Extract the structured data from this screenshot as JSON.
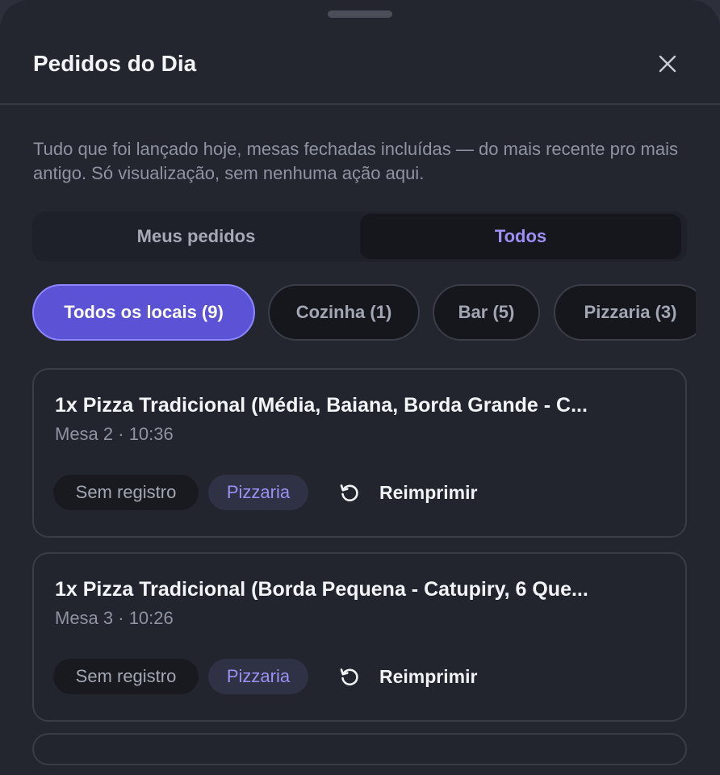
{
  "header": {
    "title": "Pedidos do Dia",
    "close_icon": "close-icon"
  },
  "description": "Tudo que foi lançado hoje, mesas fechadas incluídas — do mais recente pro mais antigo. Só visualização, sem nenhuma ação aqui.",
  "segments": {
    "mine": "Meus pedidos",
    "all": "Todos",
    "selected": "all"
  },
  "filters": [
    {
      "label": "Todos os locais (9)",
      "active": true
    },
    {
      "label": "Cozinha (1)",
      "active": false
    },
    {
      "label": "Bar (5)",
      "active": false
    },
    {
      "label": "Pizzaria (3)",
      "active": false
    }
  ],
  "orders": [
    {
      "title": "1x Pizza Tradicional (Média, Baiana, Borda Grande - C...",
      "meta": "Mesa 2 · 10:36",
      "status": "Sem registro",
      "place": "Pizzaria",
      "action": "Reimprimir",
      "action_icon": "reprint-icon"
    },
    {
      "title": "1x Pizza Tradicional (Borda Pequena - Catupiry, 6 Que...",
      "meta": "Mesa 3 · 10:26",
      "status": "Sem registro",
      "place": "Pizzaria",
      "action": "Reimprimir",
      "action_icon": "reprint-icon"
    }
  ],
  "colors": {
    "accent": "#5b52d6",
    "accent_text": "#9d8ff5",
    "sheet_bg": "#23262f",
    "text_primary": "#f3f4f7",
    "text_muted": "#8f94a3"
  }
}
